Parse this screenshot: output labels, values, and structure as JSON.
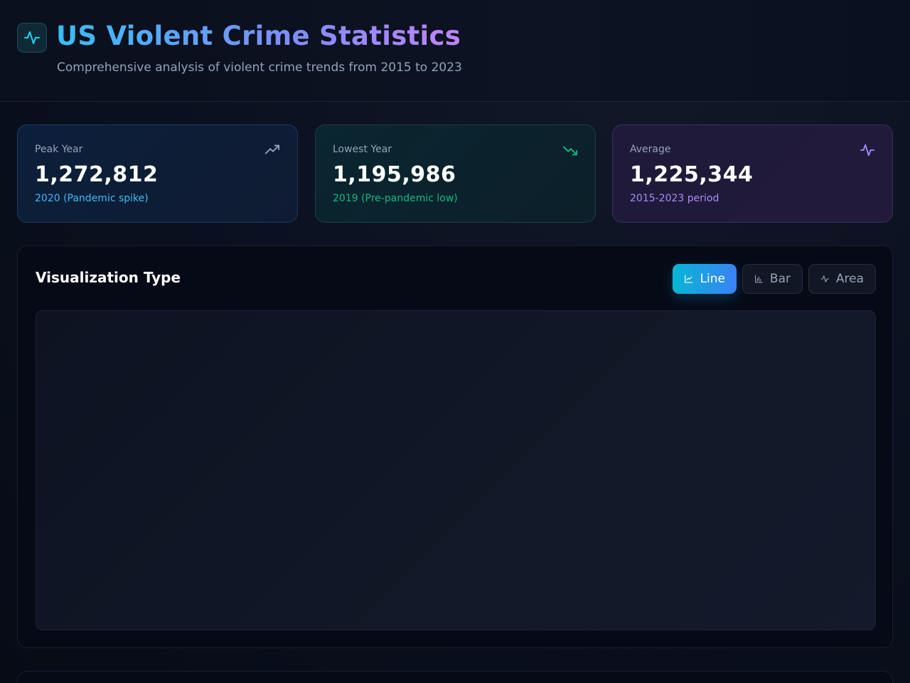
{
  "header": {
    "title": "US Violent Crime Statistics",
    "subtitle": "Comprehensive analysis of violent crime trends from 2015 to 2023",
    "logo_icon": "activity-icon"
  },
  "stats": {
    "peak": {
      "label": "Peak Year",
      "value": "1,272,812",
      "note": "2020 (Pandemic spike)",
      "icon": "trending-up-icon"
    },
    "lowest": {
      "label": "Lowest Year",
      "value": "1,195,986",
      "note": "2019 (Pre-pandemic low)",
      "icon": "trending-down-icon"
    },
    "average": {
      "label": "Average",
      "value": "1,225,344",
      "note": "2015-2023 period",
      "icon": "activity-icon"
    }
  },
  "visualization": {
    "title": "Visualization Type",
    "buttons": {
      "line": "Line",
      "bar": "Bar",
      "area": "Area"
    },
    "selected": "line"
  },
  "colors": {
    "accent_cyan": "#06b6d4",
    "accent_blue": "#3b82f6",
    "accent_green": "#10b981",
    "accent_purple": "#a78bfa"
  }
}
